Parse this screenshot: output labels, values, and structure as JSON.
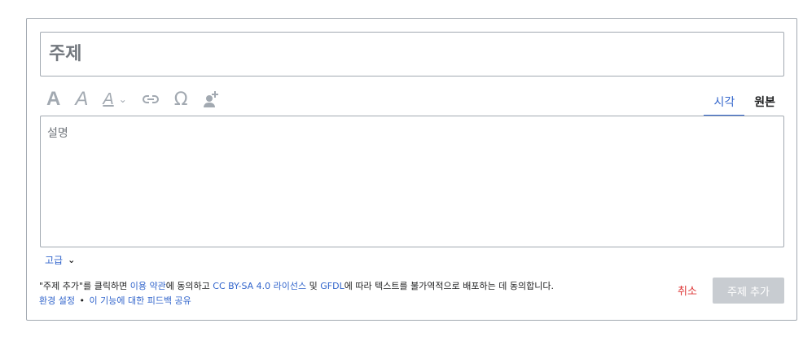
{
  "form": {
    "subject_placeholder": "주제",
    "description_placeholder": "설명",
    "advanced_label": "고급",
    "cancel_label": "취소",
    "submit_label": "주제 추가"
  },
  "toolbar": {
    "bold": "A",
    "italic": "A",
    "style": "A",
    "special_char": "Ω",
    "icons": [
      "bold-icon",
      "italic-icon",
      "text-style-icon",
      "chevron-down-icon",
      "link-icon",
      "omega-icon",
      "mention-user-icon"
    ]
  },
  "tabs": [
    {
      "label": "시각",
      "active": true
    },
    {
      "label": "원본",
      "active": false
    }
  ],
  "legal": {
    "part1": "\"주제 추가\"를 클릭하면 ",
    "terms_link": "이용 약관",
    "part2": "에 동의하고 ",
    "license_link": "CC BY-SA 4.0 라이선스",
    "part3": " 및 ",
    "gfdl_link": "GFDL",
    "part4": "에 따라 텍스트를 불가역적으로 배포하는 데 동의합니다.",
    "prefs_link": "환경 설정",
    "bullet": "•",
    "feedback_link": "이 기능에 대한 피드백 공유"
  },
  "colors": {
    "accent": "#3366cc",
    "destructive": "#d33333",
    "border": "#a2a9b1",
    "disabled_button": "#c8ccd1"
  }
}
